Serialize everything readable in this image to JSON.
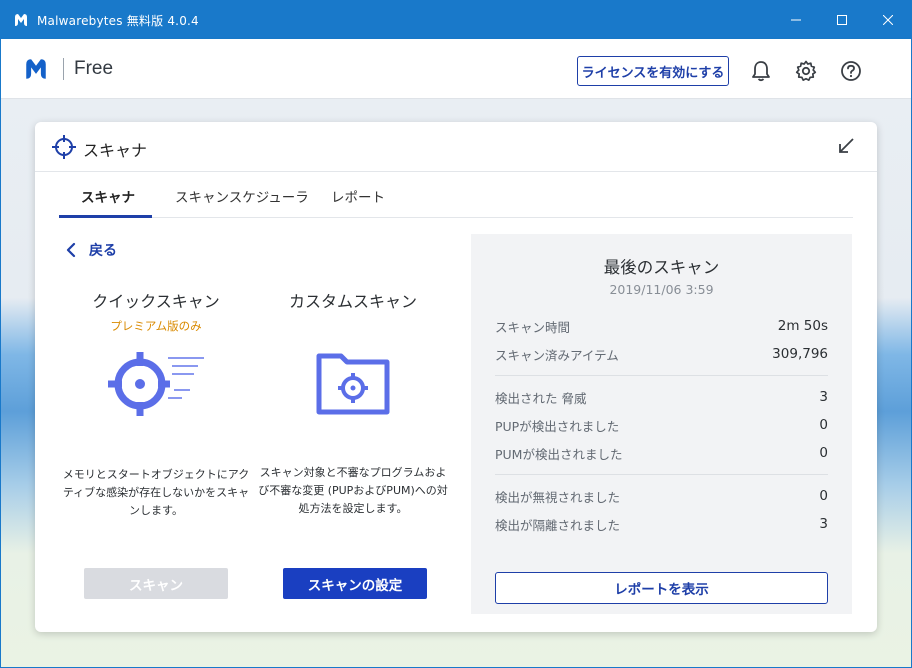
{
  "window": {
    "title": "Malwarebytes 無料版  4.0.4"
  },
  "header": {
    "edition": "Free",
    "license_button": "ライセンスを有効にする"
  },
  "card": {
    "title": "スキャナ",
    "tabs": [
      {
        "label": "スキャナ",
        "active": true
      },
      {
        "label": "スキャンスケジューラ",
        "active": false
      },
      {
        "label": "レポート",
        "active": false
      }
    ],
    "back_label": "戻る",
    "quick_scan": {
      "title": "クイックスキャン",
      "badge": "プレミアム版のみ",
      "description": "メモリとスタートオブジェクトにアクティブな感染が存在しないかをスキャンします。",
      "button": "スキャン"
    },
    "custom_scan": {
      "title": "カスタムスキャン",
      "description": "スキャン対象と不審なプログラムおよび不審な変更 (PUPおよびPUM)への対処方法を設定します。",
      "button": "スキャンの設定"
    },
    "last_scan": {
      "title": "最後のスキャン",
      "date": "2019/11/06 3:59",
      "rows": [
        {
          "label": "スキャン時間",
          "value": "2m 50s"
        },
        {
          "label": "スキャン済みアイテム",
          "value": "309,796"
        },
        {
          "label": "検出された 脅威",
          "value": "3"
        },
        {
          "label": "PUPが検出されました",
          "value": "0"
        },
        {
          "label": "PUMが検出されました",
          "value": "0"
        },
        {
          "label": "検出が無視されました",
          "value": "0"
        },
        {
          "label": "検出が隔離されました",
          "value": "3"
        }
      ],
      "report_button": "レポートを表示"
    }
  },
  "colors": {
    "brand_blue": "#1979ca",
    "accent": "#1e3fa8",
    "graphic": "#5b6ee8",
    "premium": "#d98a00"
  }
}
